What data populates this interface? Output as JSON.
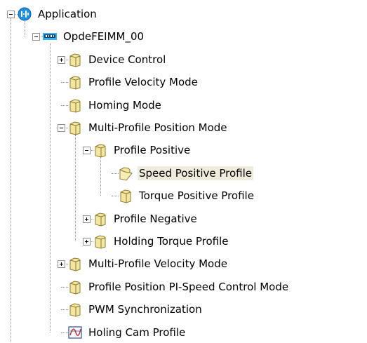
{
  "tree": {
    "nodes": [
      {
        "label": "Application",
        "icon": "application-globe-icon",
        "expander": "minus",
        "selected": false
      },
      {
        "label": "OpdeFEIMM_00",
        "icon": "device-icon",
        "expander": "minus",
        "selected": false
      },
      {
        "label": "Device Control",
        "icon": "folder-icon",
        "expander": "plus",
        "selected": false
      },
      {
        "label": "Profile Velocity Mode",
        "icon": "folder-icon",
        "expander": "none",
        "selected": false
      },
      {
        "label": "Homing Mode",
        "icon": "folder-icon",
        "expander": "none",
        "selected": false
      },
      {
        "label": "Multi-Profile Position Mode",
        "icon": "folder-icon",
        "expander": "minus",
        "selected": false
      },
      {
        "label": "Profile Positive",
        "icon": "folder-icon",
        "expander": "minus",
        "selected": false
      },
      {
        "label": "Speed Positive Profile",
        "icon": "folder-open-icon",
        "expander": "none",
        "selected": true
      },
      {
        "label": "Torque Positive Profile",
        "icon": "folder-icon",
        "expander": "none",
        "selected": false
      },
      {
        "label": "Profile Negative",
        "icon": "folder-icon",
        "expander": "plus",
        "selected": false
      },
      {
        "label": "Holding Torque Profile",
        "icon": "folder-icon",
        "expander": "plus",
        "selected": false
      },
      {
        "label": "Multi-Profile Velocity Mode",
        "icon": "folder-icon",
        "expander": "plus",
        "selected": false
      },
      {
        "label": "Profile Position PI-Speed Control Mode",
        "icon": "folder-icon",
        "expander": "none",
        "selected": false
      },
      {
        "label": "PWM Synchronization",
        "icon": "folder-icon",
        "expander": "none",
        "selected": false
      },
      {
        "label": "Holing Cam Profile",
        "icon": "cam-profile-chart-icon",
        "expander": "none",
        "selected": false
      }
    ]
  },
  "colors": {
    "selection_background": "#f0ecdd",
    "folder_fill": "#f4e6a0",
    "folder_stroke": "#8c7a2e",
    "globe_blue": "#1f8fe0",
    "device_blue": "#2fb8f0"
  }
}
